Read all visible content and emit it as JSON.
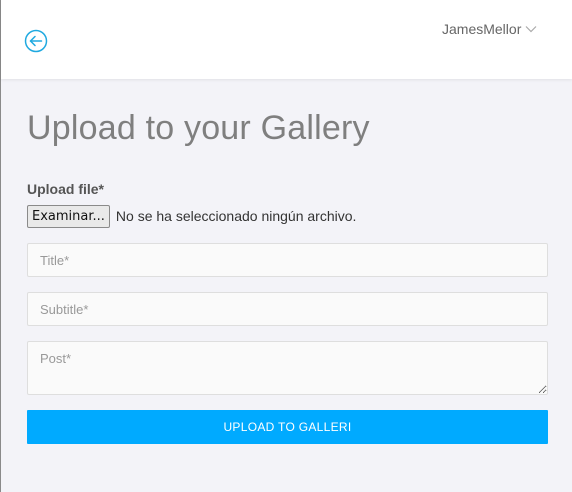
{
  "header": {
    "username": "JamesMellor",
    "back_icon": "back-arrow-circle-icon",
    "menu_icon": "chevron-down-icon"
  },
  "form": {
    "title": "Upload to your Gallery",
    "file_label": "Upload file*",
    "file_button_label": "Examinar...",
    "file_status": "No se ha seleccionado ningún archivo.",
    "title_placeholder": "Title*",
    "subtitle_placeholder": "Subtitle*",
    "post_placeholder": "Post*",
    "submit_label": "UPLOAD TO GALLERI"
  },
  "colors": {
    "accent": "#00aaff",
    "back_icon": "#1fa9e0",
    "background": "#f3f3f8"
  }
}
